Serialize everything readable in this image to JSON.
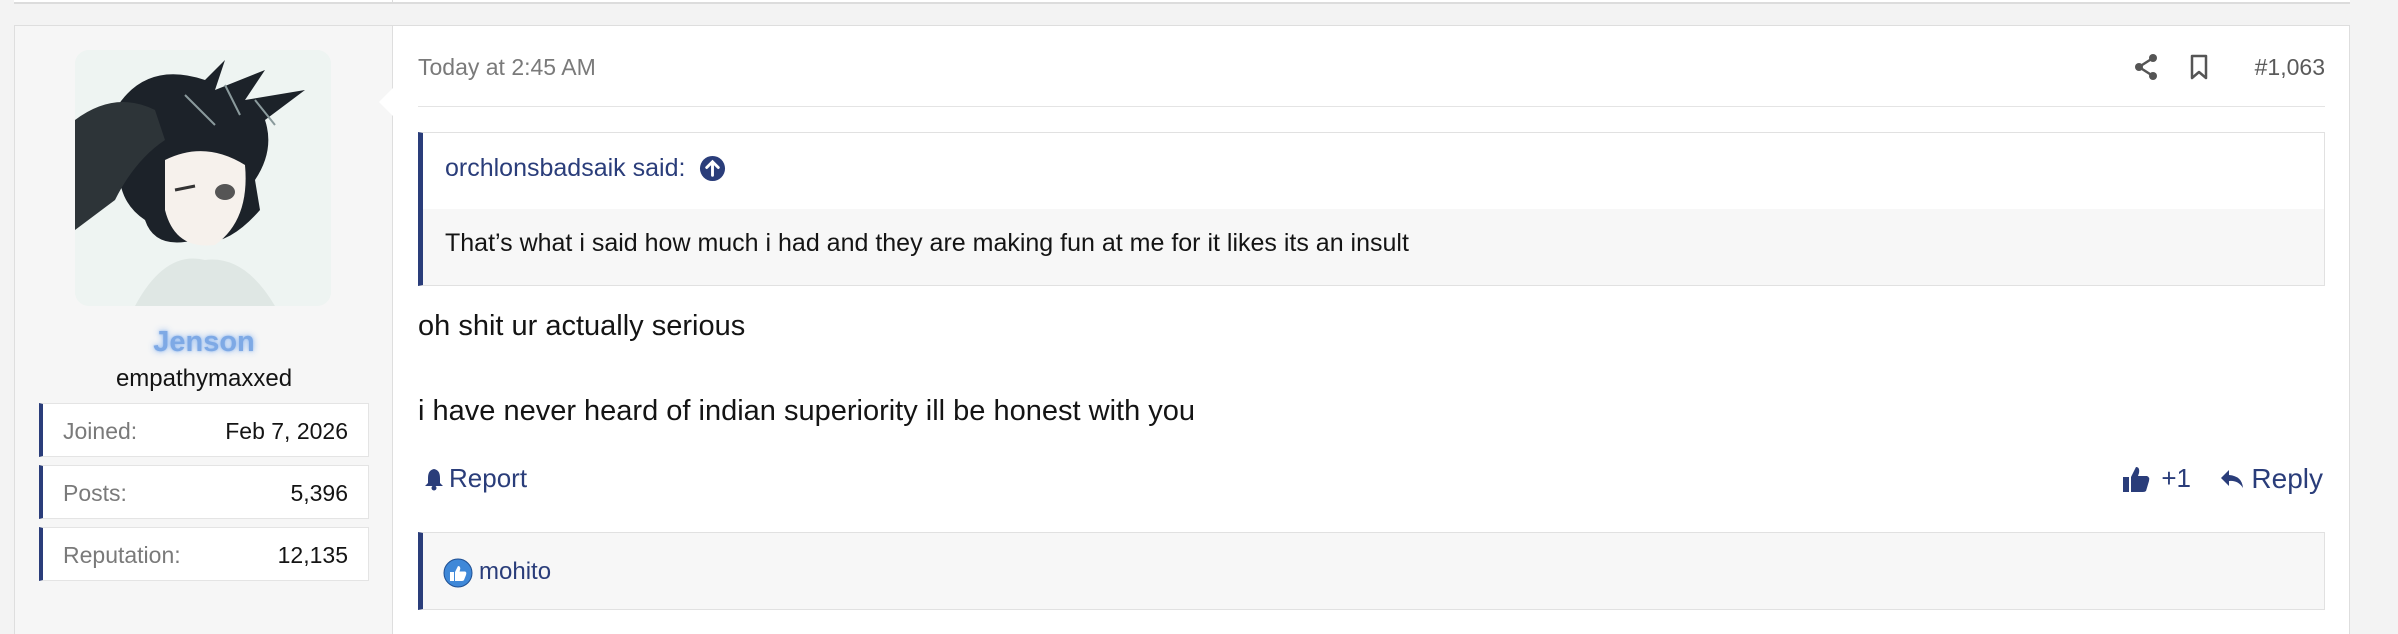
{
  "post": {
    "date": "Today at 2:45 AM",
    "number": "#1,063",
    "icons": {
      "share": "share-icon",
      "bookmark": "bookmark-icon"
    }
  },
  "user": {
    "name": "Jenson",
    "title": "empathymaxxed",
    "name_color": "#7ea9e5",
    "stats": [
      {
        "label": "Joined:",
        "value": "Feb 7, 2026"
      },
      {
        "label": "Posts:",
        "value": "5,396"
      },
      {
        "label": "Reputation:",
        "value": "12,135"
      }
    ]
  },
  "quote": {
    "author": "orchlonsbadsaik said:",
    "text": "That’s what i said how much i had and they are making fun at me for it likes its an insult"
  },
  "message": {
    "lines": [
      "oh shit ur actually serious",
      "i have never heard of indian superiority ill be honest with you"
    ]
  },
  "actions": {
    "report": "Report",
    "like": "+1",
    "reply": "Reply"
  },
  "reactions": {
    "users": "mohito"
  },
  "colors": {
    "accent": "#2a3d7a",
    "muted": "#7a7a7a"
  }
}
